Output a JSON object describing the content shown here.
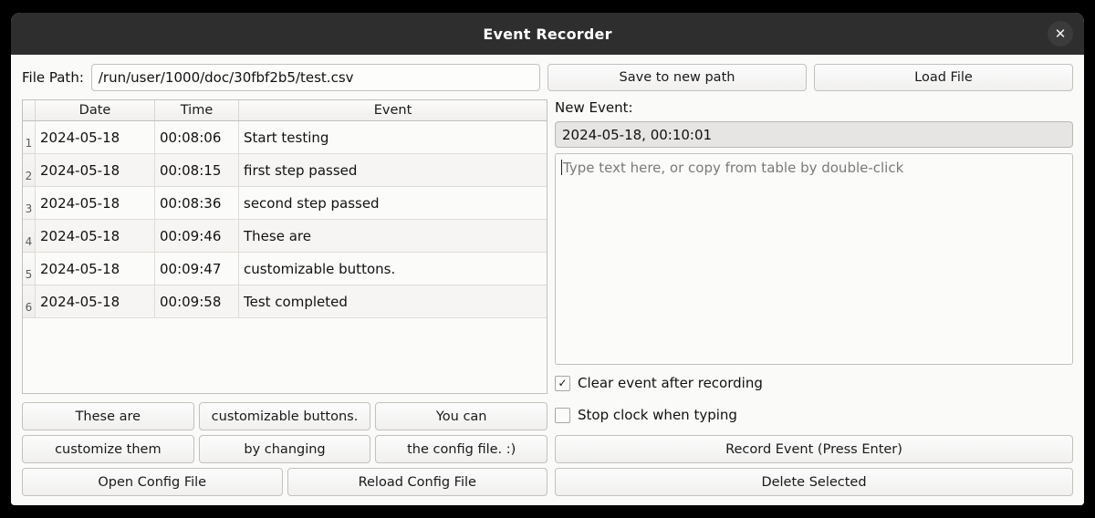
{
  "window": {
    "title": "Event Recorder",
    "close_icon": "✕"
  },
  "toolbar": {
    "file_path_label": "File Path:",
    "file_path_value": "/run/user/1000/doc/30fbf2b5/test.csv",
    "save_to_new_path_label": "Save to new path",
    "load_file_label": "Load File"
  },
  "table": {
    "columns": [
      "Date",
      "Time",
      "Event"
    ],
    "rows": [
      {
        "index": "1",
        "date": "2024-05-18",
        "time": "00:08:06",
        "event": "Start testing"
      },
      {
        "index": "2",
        "date": "2024-05-18",
        "time": "00:08:15",
        "event": "first step passed"
      },
      {
        "index": "3",
        "date": "2024-05-18",
        "time": "00:08:36",
        "event": "second step passed"
      },
      {
        "index": "4",
        "date": "2024-05-18",
        "time": "00:09:46",
        "event": "These are"
      },
      {
        "index": "5",
        "date": "2024-05-18",
        "time": "00:09:47",
        "event": "customizable buttons."
      },
      {
        "index": "6",
        "date": "2024-05-18",
        "time": "00:09:58",
        "event": "Test completed"
      }
    ]
  },
  "custom_buttons": [
    "These are",
    "customizable buttons.",
    "You can",
    "customize them",
    "by changing",
    "the config file. :)"
  ],
  "config_buttons": {
    "open_label": "Open Config File",
    "reload_label": "Reload Config File"
  },
  "new_event": {
    "label": "New Event:",
    "timestamp": "2024-05-18, 00:10:01",
    "placeholder": "Type text here, or copy from table by double-click",
    "text_value": ""
  },
  "options": {
    "clear_after_recording": {
      "label": "Clear event after recording",
      "checked_mark": "✓"
    },
    "stop_clock_when_typing": {
      "label": "Stop clock when typing",
      "checked_mark": ""
    }
  },
  "actions": {
    "record_label": "Record Event (Press Enter)",
    "delete_label": "Delete Selected"
  }
}
